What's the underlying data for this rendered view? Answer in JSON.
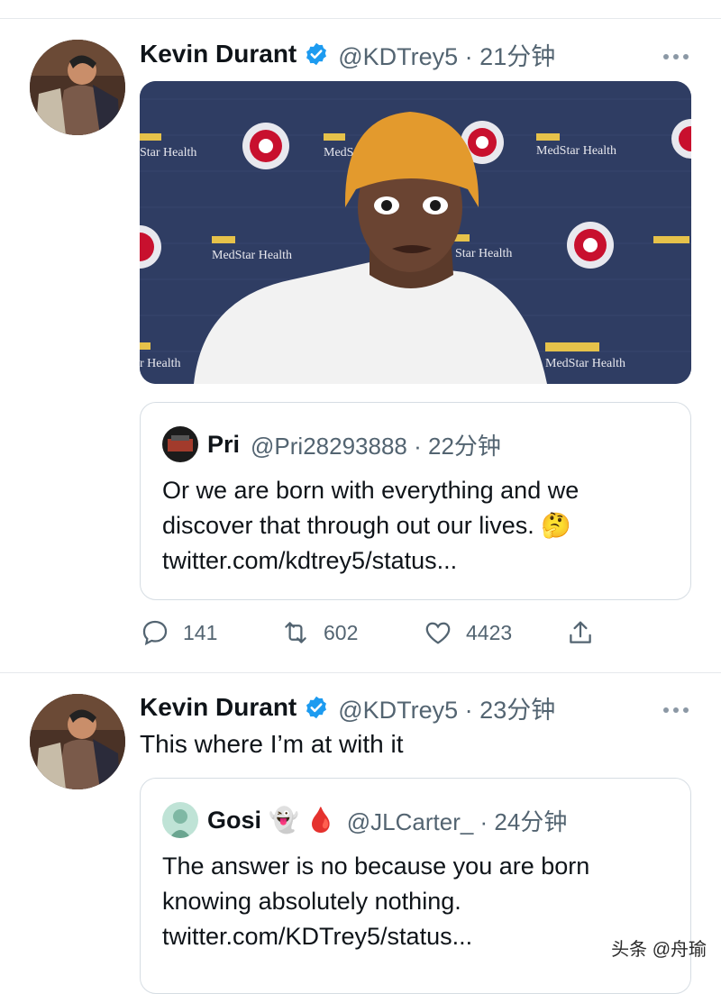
{
  "tweets": [
    {
      "author_name": "Kevin Durant",
      "author_handle": "@KDTrey5 · 21分钟",
      "media": {
        "sponsor_text": "MedStar Health",
        "sponsor_text_left_crop": "Star Health",
        "sponsor_text_bottom_left_crop": "r Health",
        "sponsor_text_top_crop": "MedS"
      },
      "quote": {
        "name": "Pri",
        "handle": "@Pri28293888 · 22分钟",
        "lines": [
          "Or we are born with everything and we",
          "discover that through out our lives. 🤔",
          "twitter.com/kdtrey5/status..."
        ]
      },
      "actions": {
        "replies": "141",
        "retweets": "602",
        "likes": "4423"
      }
    },
    {
      "author_name": "Kevin Durant",
      "author_handle": "@KDTrey5 · 23分钟",
      "text": "This where I’m at with it",
      "quote": {
        "name": "Gosi",
        "emojis": "👻 🩸",
        "handle": "@JLCarter_ · 24分钟",
        "lines": [
          "The answer is no because you are born",
          "knowing absolutely nothing.",
          "twitter.com/KDTrey5/status..."
        ]
      }
    }
  ],
  "watermark": "头条 @舟瑜",
  "colors": {
    "verified": "#1d9bf0",
    "secondary_text": "#536471",
    "border": "#e6e9ec",
    "backdrop": "#2f3d63"
  }
}
